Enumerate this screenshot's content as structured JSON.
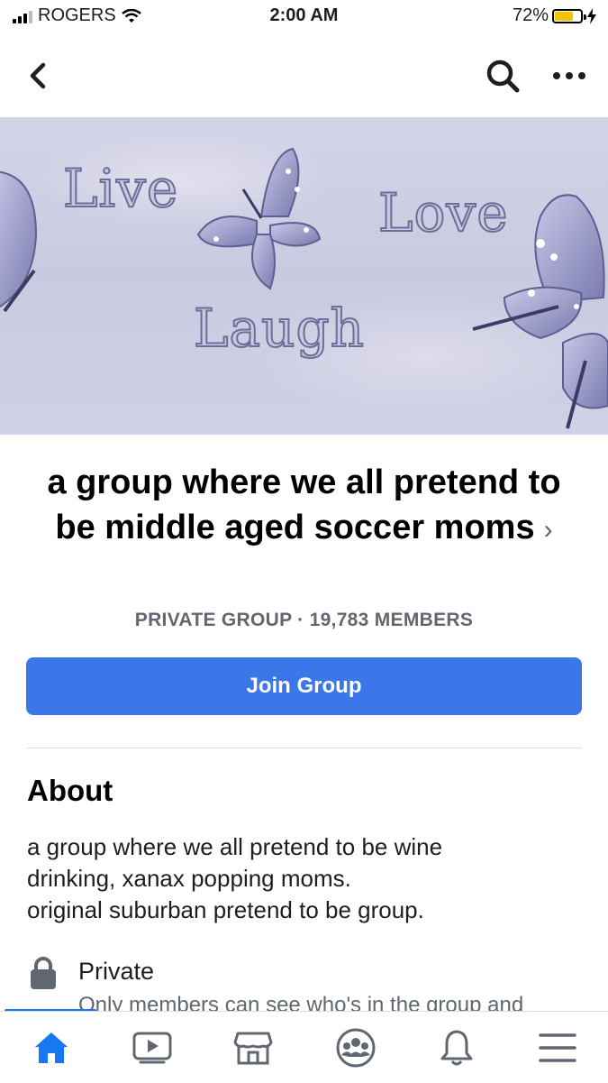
{
  "status_bar": {
    "carrier": "ROGERS",
    "time": "2:00 AM",
    "battery_percent": "72%",
    "battery_level": 0.72,
    "signal_icon": "cellular-signal-icon",
    "wifi_icon": "wifi-icon",
    "charging_icon": "charging-bolt-icon"
  },
  "nav": {
    "back_icon": "chevron-left-icon",
    "search_icon": "search-icon",
    "more_icon": "more-horizontal-icon"
  },
  "cover": {
    "words": [
      "Live",
      "Love",
      "Laugh"
    ],
    "image_icon": "butterfly-icon"
  },
  "group": {
    "title": "a group where we all pretend to be middle aged soccer moms",
    "title_chevron": "›",
    "meta": "PRIVATE GROUP · 19,783 MEMBERS",
    "join_label": "Join Group"
  },
  "about": {
    "heading": "About",
    "lines": [
      "a group where we all pretend to be wine",
      "drinking, xanax popping moms.",
      "original suburban pretend to be group."
    ],
    "privacy_icon": "lock-icon",
    "privacy_label": "Private",
    "privacy_description": "Only members can see who's in the group and"
  },
  "tabs": [
    {
      "name": "home",
      "icon": "home-icon",
      "active": true
    },
    {
      "name": "watch",
      "icon": "video-icon",
      "active": false
    },
    {
      "name": "marketplace",
      "icon": "marketplace-icon",
      "active": false
    },
    {
      "name": "groups",
      "icon": "groups-icon",
      "active": false
    },
    {
      "name": "notifications",
      "icon": "bell-icon",
      "active": false
    },
    {
      "name": "menu",
      "icon": "menu-icon",
      "active": false
    }
  ],
  "colors": {
    "accent": "#1877f2",
    "join_button": "#3b77e8",
    "meta_text": "#606770",
    "battery": "#f5c400"
  }
}
